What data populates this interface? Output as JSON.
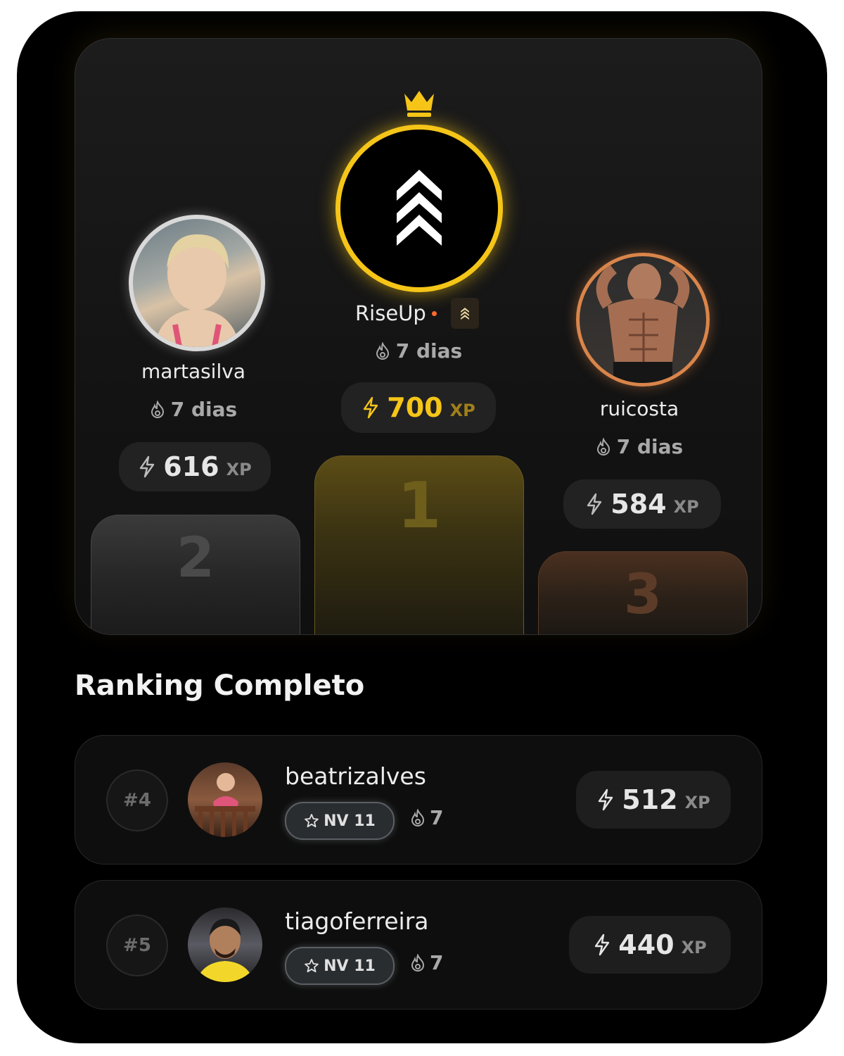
{
  "podium": {
    "first": {
      "name": "RiseUp",
      "streak": "7 dias",
      "xp": "700",
      "xp_unit": "XP",
      "place": "1"
    },
    "second": {
      "name": "martasilva",
      "streak": "7 dias",
      "xp": "616",
      "xp_unit": "XP",
      "place": "2"
    },
    "third": {
      "name": "ruicosta",
      "streak": "7 dias",
      "xp": "584",
      "xp_unit": "XP",
      "place": "3"
    }
  },
  "section_title": "Ranking Completo",
  "ranking": [
    {
      "rank": "#4",
      "name": "beatrizalves",
      "level": "NV 11",
      "streak": "7",
      "xp": "512",
      "xp_unit": "XP"
    },
    {
      "rank": "#5",
      "name": "tiagoferreira",
      "level": "NV 11",
      "streak": "7",
      "xp": "440",
      "xp_unit": "XP"
    }
  ],
  "colors": {
    "gold": "#f5c518",
    "silver": "#d9d9d9",
    "bronze": "#d9854a",
    "background": "#000000"
  },
  "icons": [
    "crown-icon",
    "riseup-logo-icon",
    "flame-icon",
    "bolt-icon",
    "star-icon",
    "verified-badge-icon"
  ]
}
